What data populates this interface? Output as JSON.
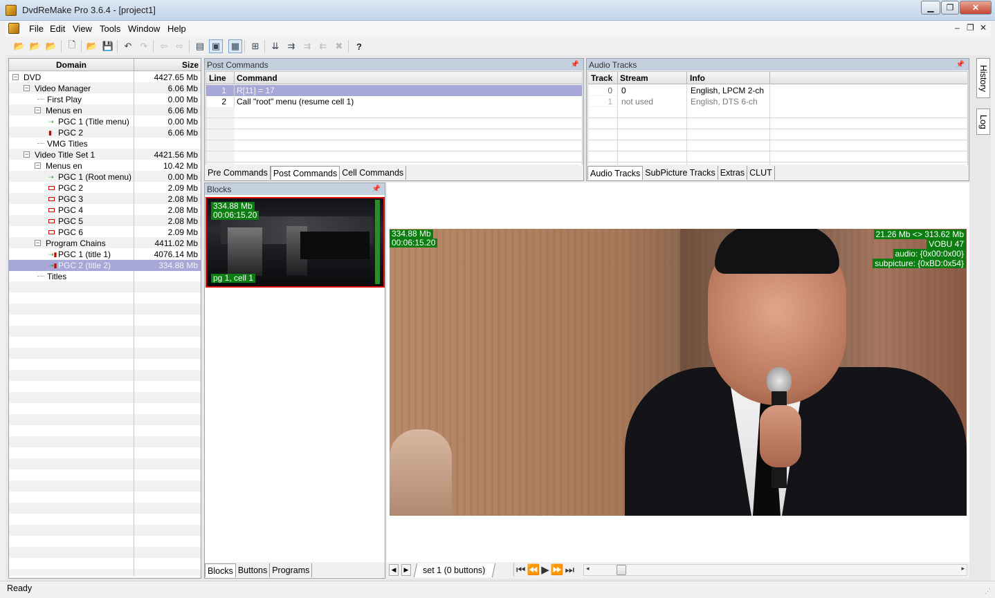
{
  "window": {
    "title": "DvdReMake Pro 3.6.4 - [project1]",
    "min": "▁",
    "max": "❐",
    "close": "✕"
  },
  "menu": {
    "items": [
      "File",
      "Edit",
      "View",
      "Tools",
      "Window",
      "Help"
    ],
    "mdi_min": "–",
    "mdi_restore": "❐",
    "mdi_close": "✕"
  },
  "toolbar": {
    "icons": [
      "open-project-icon",
      "open-vob-icon",
      "remake-icon",
      "new-icon",
      "open-icon",
      "save-icon",
      "undo-icon",
      "redo-icon",
      "back-icon",
      "forward-icon",
      "view-list-icon",
      "view-blocks-icon",
      "view-preview-icon",
      "tree-icon",
      "move-down-icon",
      "move-icon",
      "move-disabled-icon",
      "move-disabled2-icon",
      "delete-disabled-icon",
      "help-icon"
    ]
  },
  "tree": {
    "columns": {
      "domain": "Domain",
      "size": "Size"
    },
    "rows": [
      {
        "label": "DVD",
        "size": "4427.65 Mb"
      },
      {
        "label": "Video Manager",
        "size": "6.06 Mb"
      },
      {
        "label": "First Play",
        "size": "0.00 Mb"
      },
      {
        "label": "Menus en",
        "size": "6.06 Mb"
      },
      {
        "label": "PGC 1 (Title menu)",
        "size": "0.00 Mb"
      },
      {
        "label": "PGC 2",
        "size": "6.06 Mb"
      },
      {
        "label": "VMG Titles",
        "size": ""
      },
      {
        "label": "Video Title Set 1",
        "size": "4421.56 Mb"
      },
      {
        "label": "Menus en",
        "size": "10.42 Mb"
      },
      {
        "label": "PGC 1 (Root menu)",
        "size": "0.00 Mb"
      },
      {
        "label": "PGC 2",
        "size": "2.09 Mb"
      },
      {
        "label": "PGC 3",
        "size": "2.08 Mb"
      },
      {
        "label": "PGC 4",
        "size": "2.08 Mb"
      },
      {
        "label": "PGC 5",
        "size": "2.08 Mb"
      },
      {
        "label": "PGC 6",
        "size": "2.09 Mb"
      },
      {
        "label": "Program Chains",
        "size": "4411.02 Mb"
      },
      {
        "label": "PGC 1  (title 1)",
        "size": "4076.14 Mb"
      },
      {
        "label": "PGC 2  (title 2)",
        "size": "334.88 Mb"
      },
      {
        "label": "Titles",
        "size": ""
      }
    ]
  },
  "post_commands": {
    "caption": "Post Commands",
    "columns": {
      "line": "Line",
      "command": "Command"
    },
    "rows": [
      {
        "line": "1",
        "command": "R[11] = 17"
      },
      {
        "line": "2",
        "command": "Call \"root\" menu (resume cell 1)"
      }
    ],
    "tabs": [
      "Pre Commands",
      "Post Commands",
      "Cell Commands"
    ]
  },
  "audio_tracks": {
    "caption": "Audio Tracks",
    "columns": {
      "track": "Track",
      "stream": "Stream",
      "info": "Info"
    },
    "rows": [
      {
        "track": "0",
        "stream": "0",
        "info": "English,  LPCM 2-ch"
      },
      {
        "track": "1",
        "stream": "not used",
        "info": "English,  DTS 6-ch"
      }
    ],
    "tabs": [
      "Audio Tracks",
      "SubPicture Tracks",
      "Extras",
      "CLUT"
    ]
  },
  "blocks": {
    "caption": "Blocks",
    "thumb": {
      "size": "334.88 Mb",
      "time": "00:06:15.20",
      "cell": "pg 1, cell 1"
    },
    "tabs": [
      "Blocks",
      "Buttons",
      "Programs"
    ]
  },
  "preview": {
    "left_size": "334.88 Mb",
    "left_time": "00:06:15.20",
    "right_lines": [
      "21.26 Mb <> 313.62 Mb",
      "VOBU 47",
      "audio: {0x00:0x00}",
      "subpicture: {0xBD:0x54}"
    ],
    "set_tab": "set 1 (0 buttons)",
    "nav": [
      "⏮",
      "⏪",
      "▶",
      "⏩",
      "⏭"
    ]
  },
  "side_tabs": [
    "History",
    "Log"
  ],
  "status": "Ready",
  "colors": {
    "selection": "#a8a8d8",
    "caption": "#c4d0de",
    "overlay": "#0c7d10",
    "thumb_border": "#e01010"
  }
}
